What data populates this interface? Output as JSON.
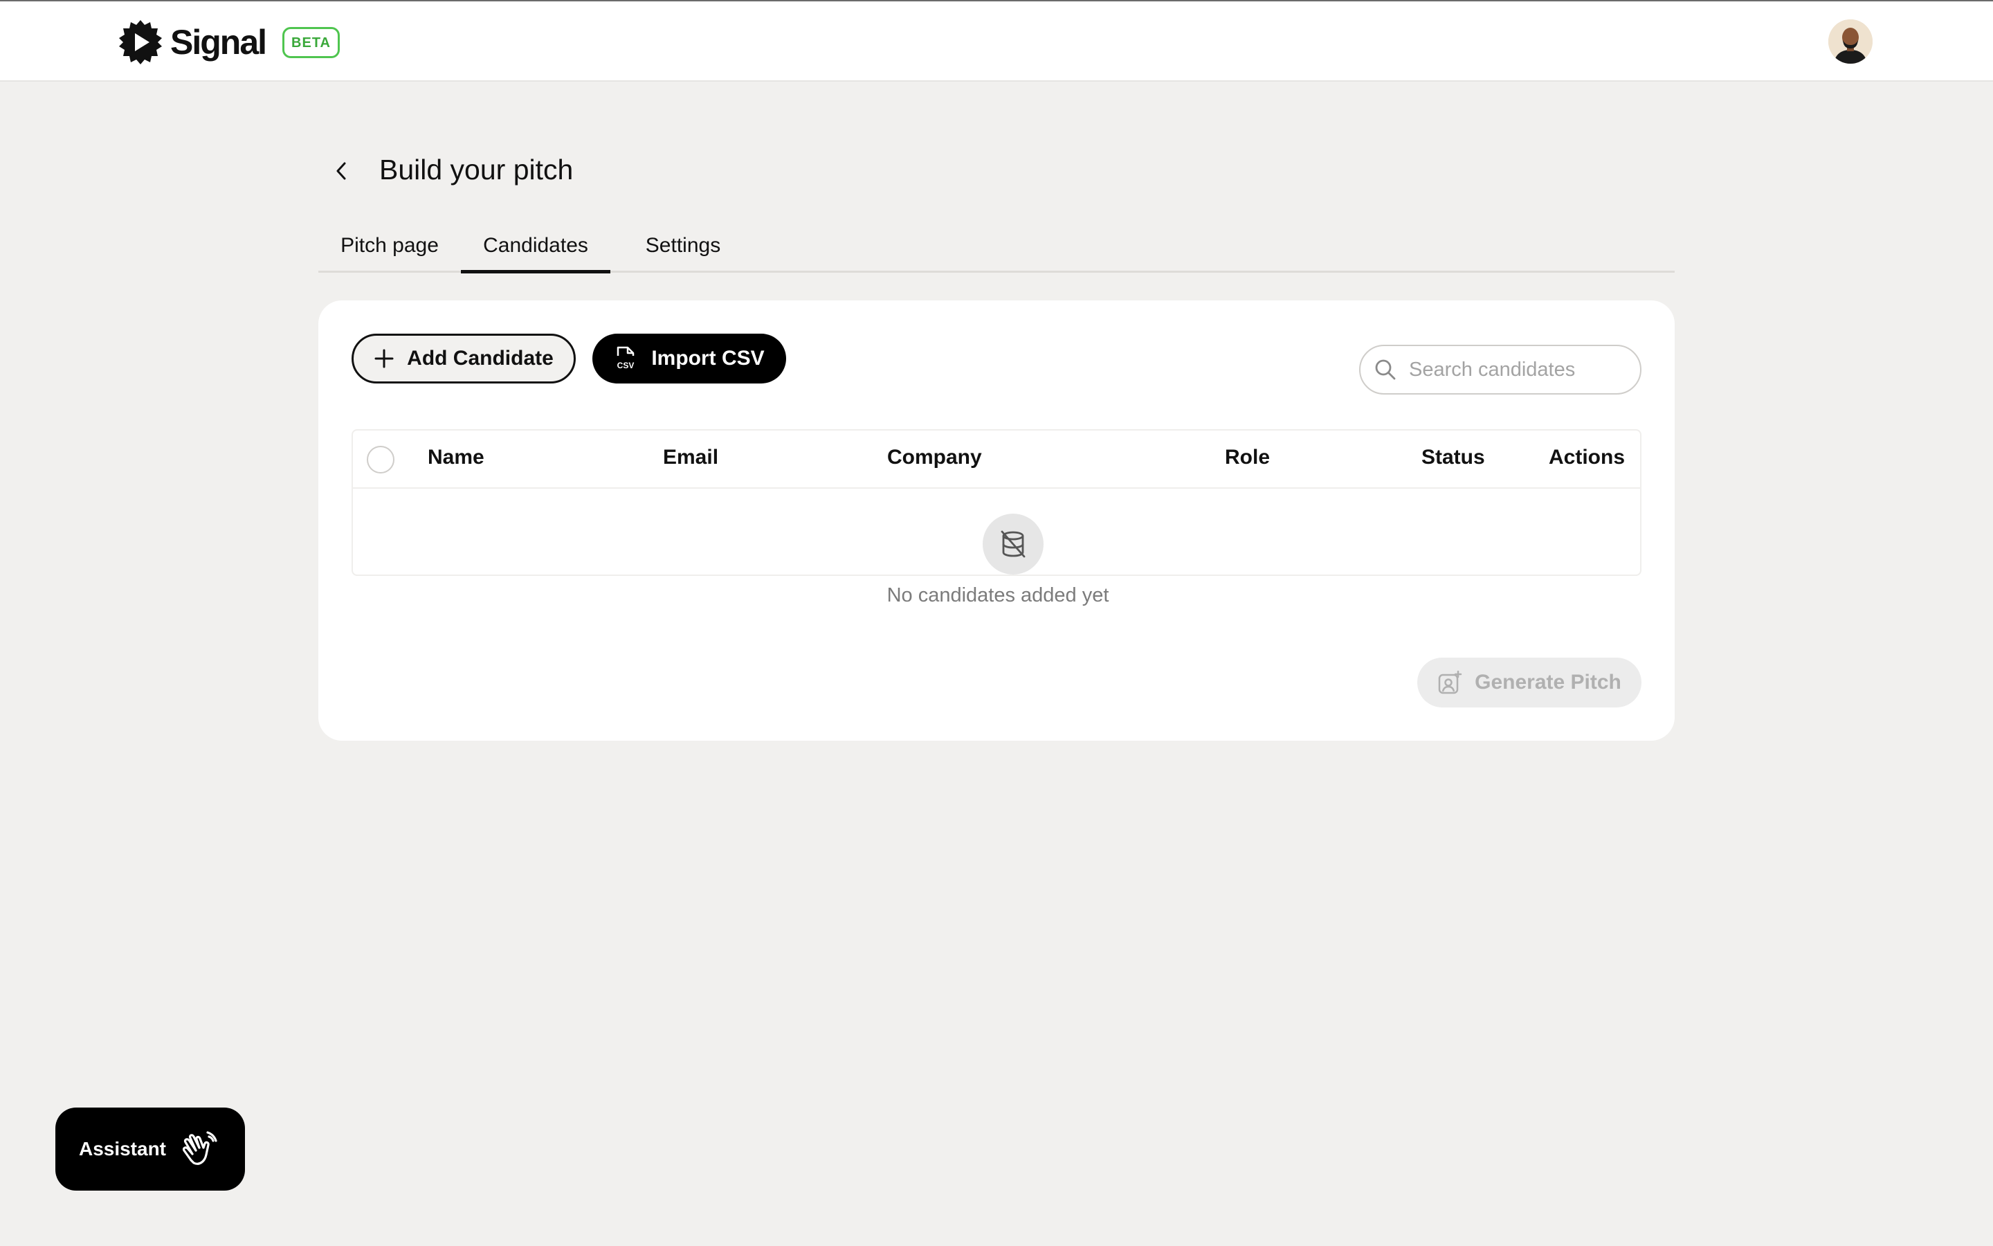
{
  "header": {
    "brand": "Signal",
    "badge": "BETA",
    "logo_icon": "signal-play-badge-icon",
    "avatar_icon": "user-avatar"
  },
  "page": {
    "title": "Build your pitch",
    "back_icon": "chevron-left-icon"
  },
  "tabs": [
    {
      "label": "Pitch page",
      "active": false
    },
    {
      "label": "Candidates",
      "active": true
    },
    {
      "label": "Settings",
      "active": false
    }
  ],
  "toolbar": {
    "add_label": "Add Candidate",
    "import_label": "Import CSV",
    "search_placeholder": "Search candidates",
    "search_value": ""
  },
  "table": {
    "columns": [
      "Name",
      "Email",
      "Company",
      "Role",
      "Status",
      "Actions"
    ],
    "rows": [],
    "empty_text": "No candidates added yet",
    "empty_icon": "database-off-icon"
  },
  "footer": {
    "generate_label": "Generate Pitch",
    "generate_enabled": false
  },
  "assistant": {
    "label": "Assistant",
    "icon": "waving-hand-icon"
  },
  "colors": {
    "background": "#f1f0ee",
    "card": "#ffffff",
    "primary": "#000000",
    "beta": "#4fc54f",
    "disabled": "#ececec"
  }
}
